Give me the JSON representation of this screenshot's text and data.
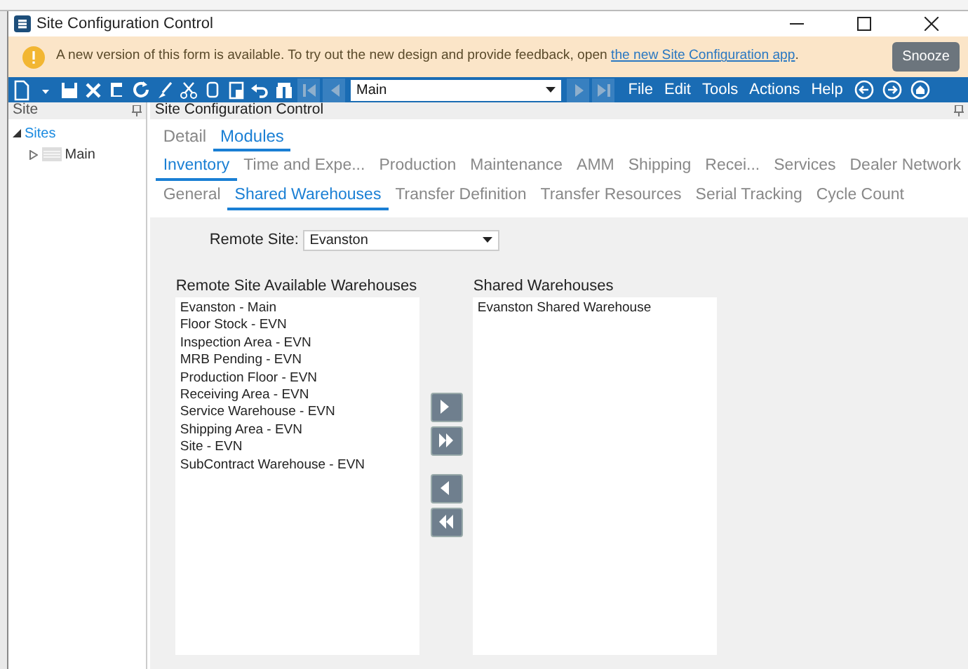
{
  "window": {
    "title": "Site Configuration Control"
  },
  "banner": {
    "message": "A new version of this form is available. To try out the new design and provide feedback, open ",
    "link": "the new Site Configuration app",
    "end": ".",
    "button": "Snooze"
  },
  "toolbar": {
    "nav_buttons": [
      {
        "kind": "first",
        "disabled": true
      },
      {
        "kind": "prev",
        "disabled": true
      }
    ],
    "combo": "Main",
    "nav_buttons_after": [
      {
        "kind": "next",
        "disabled": true
      },
      {
        "kind": "last",
        "disabled": true
      }
    ],
    "menus": [
      "File",
      "Edit",
      "Tools",
      "Actions",
      "Help"
    ]
  },
  "site_pane": {
    "title": "Site",
    "tree": [
      {
        "label": "Sites",
        "expanded": true,
        "children": [
          {
            "label": "Main",
            "expanded": false
          }
        ]
      }
    ]
  },
  "main_pane": {
    "title": "Site Configuration Control",
    "tab_rows": [
      [
        {
          "label": "Detail",
          "selected": false
        },
        {
          "label": "Modules",
          "selected": true
        }
      ],
      [
        {
          "label": "Inventory",
          "selected": true
        },
        {
          "label": "Time and Expe...",
          "selected": false
        },
        {
          "label": "Production",
          "selected": false
        },
        {
          "label": "Maintenance",
          "selected": false
        },
        {
          "label": "AMM",
          "selected": false
        },
        {
          "label": "Shipping",
          "selected": false
        },
        {
          "label": "Recei...",
          "selected": false
        },
        {
          "label": "Services",
          "selected": false
        },
        {
          "label": "Dealer Network",
          "selected": false
        }
      ],
      [
        {
          "label": "General",
          "selected": false
        },
        {
          "label": "Shared Warehouses",
          "selected": true
        },
        {
          "label": "Transfer Definition",
          "selected": false
        },
        {
          "label": "Transfer Resources",
          "selected": false
        },
        {
          "label": "Serial Tracking",
          "selected": false
        },
        {
          "label": "Cycle Count",
          "selected": false
        }
      ]
    ],
    "remote_site": {
      "label": "Remote Site:",
      "value": "Evanston"
    },
    "available": {
      "title": "Remote Site Available Warehouses",
      "items": [
        "Evanston - Main",
        "Floor Stock - EVN",
        "Inspection Area  - EVN",
        "MRB Pending - EVN",
        "Production Floor - EVN",
        "Receiving Area - EVN",
        "Service Warehouse - EVN",
        "Shipping Area - EVN",
        "Site - EVN",
        "SubContract Warehouse - EVN"
      ]
    },
    "shared": {
      "title": "Shared Warehouses",
      "items": [
        "Evanston Shared Warehouse"
      ]
    }
  }
}
